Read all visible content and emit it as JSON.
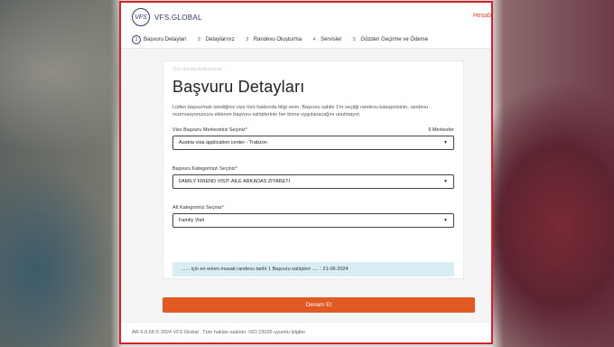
{
  "header": {
    "logo_mark": "VFS",
    "logo_text": "VFS.GLOBAL",
    "top_right_link": "Hesabı"
  },
  "steps": [
    {
      "num": "1",
      "label": "Başvuru Detayları",
      "active": true
    },
    {
      "num": "2",
      "label": "Detaylarınız",
      "active": false
    },
    {
      "num": "3",
      "label": "Randevu Oluşturma",
      "active": false
    },
    {
      "num": "4",
      "label": "Servisler",
      "active": false
    },
    {
      "num": "5",
      "label": "Gözden Geçirme ve Ödeme",
      "active": false
    }
  ],
  "form": {
    "faded_note": "Tüm alanlar doldurulmalı ...",
    "title": "Başvuru Detayları",
    "description": "Lütfen başvurmak istediğiniz vize türü hakkında bilgi verin. Başvuru sahibi 1'in seçtiği randevu kategorisinin, randevu rezervasyonunuza eklenen başvuru sahiplerinin her birine uygulanacağını unutmayın.",
    "center_label": "Vize Başvuru Merkezinizi Seçiniz",
    "center_count": "9 Merkezler",
    "center_value": "Austria visa application center - Trabzon",
    "category_label": "Başvuru Kategorinizi Seçiniz",
    "category_value": "FAMILY FRIEND VISIT-AILE ARKADAS ZIYARETI",
    "subcategory_label": "Alt Kategoriniz Seçiniz",
    "subcategory_value": "Family Visit",
    "required_mark": "*",
    "alert_text": "...... için en erken musait randevu tarihi 1 Başvuru sahipleri ..... : 21-06-2024"
  },
  "cta_label": "Devam Et",
  "footer_text": "AR-6.0.68 © 2024 VFS Global . Tüm hakları saklıdır. ISO 23026 uyumlu bilgiler",
  "colors": {
    "accent": "#e15a23",
    "brand": "#2b3a67",
    "frame_border": "#d6202a",
    "alert_bg": "#d8eef2"
  },
  "icons": {
    "chevron": "chevron-down-icon"
  }
}
